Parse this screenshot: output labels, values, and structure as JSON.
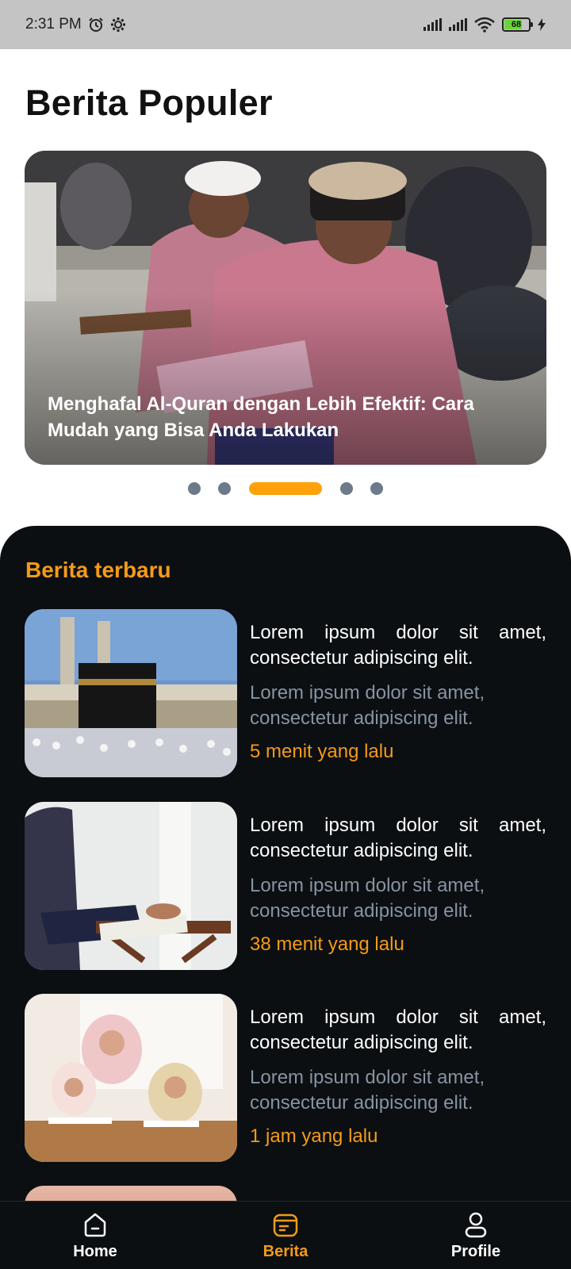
{
  "status_bar": {
    "time": "2:31 PM",
    "battery": "68"
  },
  "header": {
    "title": "Berita Populer"
  },
  "featured": {
    "title": "Menghafal Al-Quran dengan Lebih Efektif: Cara Mudah yang Bisa Anda Lakukan",
    "pages": 5,
    "active_page": 3
  },
  "latest": {
    "section_title": "Berita terbaru",
    "items": [
      {
        "title": "Lorem ipsum dolor sit amet, consectetur adipiscing elit.",
        "summary": "Lorem ipsum dolor sit amet, consectetur adipiscing elit.",
        "time": "5 menit yang lalu",
        "image": "kaaba-photo"
      },
      {
        "title": "Lorem ipsum dolor sit amet, consectetur adipiscing elit.",
        "summary": "Lorem ipsum dolor sit amet, consectetur adipiscing elit.",
        "time": "38 menit yang lalu",
        "image": "quran-reading-photo"
      },
      {
        "title": "Lorem ipsum dolor sit amet, consectetur adipiscing elit.",
        "summary": "Lorem ipsum dolor sit amet, consectetur adipiscing elit.",
        "time": "1 jam yang lalu",
        "image": "girls-studying-photo"
      }
    ]
  },
  "bottom_nav": {
    "items": [
      {
        "label": "Home",
        "icon": "home-icon",
        "active": false
      },
      {
        "label": "Berita",
        "icon": "news-icon",
        "active": true
      },
      {
        "label": "Profile",
        "icon": "profile-icon",
        "active": false
      }
    ]
  },
  "colors": {
    "accent": "#f59a1a",
    "panel": "#0b0f12",
    "muted_text": "#8893a1",
    "status_bar": "#c4c4c4"
  }
}
